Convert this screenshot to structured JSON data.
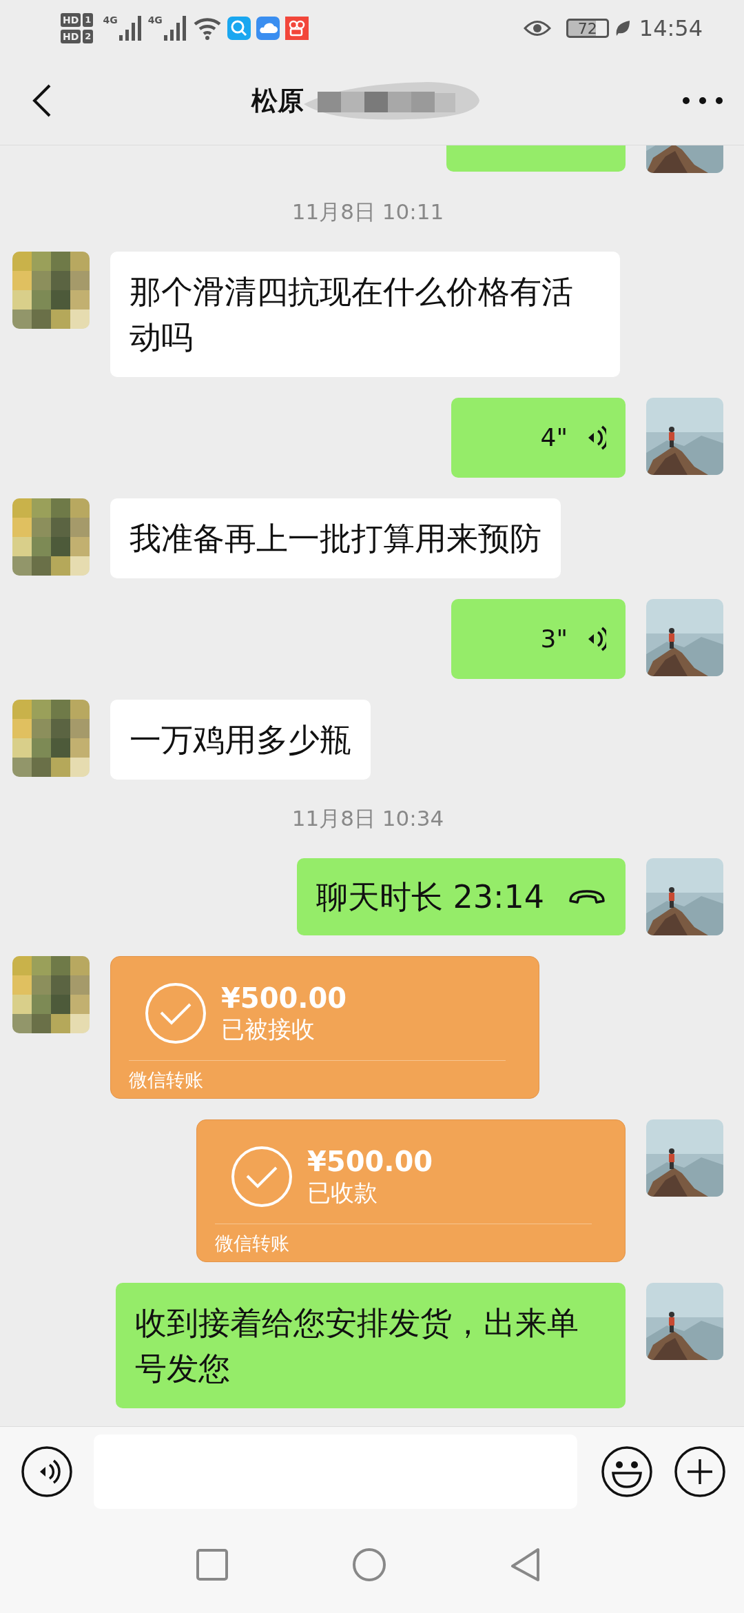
{
  "status_bar": {
    "sims": [
      {
        "badge": "HD",
        "slot": "1"
      },
      {
        "badge": "HD",
        "slot": "2"
      }
    ],
    "networks": [
      "4G",
      "4G"
    ],
    "battery": "72",
    "time": "14:54"
  },
  "header": {
    "title": "松原"
  },
  "messages": [
    {
      "kind": "partial",
      "outgoing": true
    },
    {
      "kind": "time",
      "text": "11月8日 10:11"
    },
    {
      "kind": "text",
      "outgoing": false,
      "text": "那个滑清四抗现在什么价格有活动吗"
    },
    {
      "kind": "voice",
      "outgoing": true,
      "duration": "4\""
    },
    {
      "kind": "text",
      "outgoing": false,
      "text": "我准备再上一批打算用来预防"
    },
    {
      "kind": "voice",
      "outgoing": true,
      "duration": "3\""
    },
    {
      "kind": "text",
      "outgoing": false,
      "text": "一万鸡用多少瓶"
    },
    {
      "kind": "time",
      "text": "11月8日 10:34"
    },
    {
      "kind": "call",
      "outgoing": true,
      "text": "聊天时长 23:14"
    },
    {
      "kind": "transfer",
      "outgoing": false,
      "amount": "¥500.00",
      "status": "已被接收",
      "footer": "微信转账"
    },
    {
      "kind": "transfer",
      "outgoing": true,
      "amount": "¥500.00",
      "status": "已收款",
      "footer": "微信转账"
    },
    {
      "kind": "text",
      "outgoing": true,
      "text": "收到接着给您安排发货，出来单号发您"
    }
  ]
}
